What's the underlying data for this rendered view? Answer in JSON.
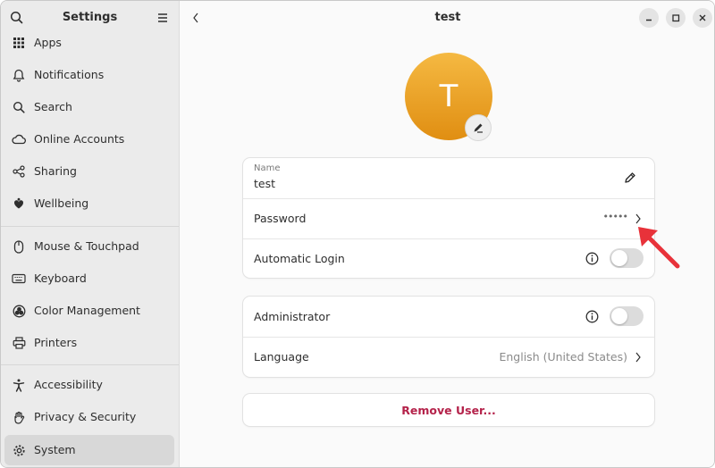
{
  "sidebar": {
    "title": "Settings",
    "items": [
      {
        "label": "Apps",
        "icon": "apps-grid-icon"
      },
      {
        "label": "Notifications",
        "icon": "bell-icon"
      },
      {
        "label": "Search",
        "icon": "search-icon"
      },
      {
        "label": "Online Accounts",
        "icon": "cloud-icon"
      },
      {
        "label": "Sharing",
        "icon": "share-icon"
      },
      {
        "label": "Wellbeing",
        "icon": "wellbeing-icon"
      },
      {
        "label": "Mouse & Touchpad",
        "icon": "mouse-icon"
      },
      {
        "label": "Keyboard",
        "icon": "keyboard-icon"
      },
      {
        "label": "Color Management",
        "icon": "color-icon"
      },
      {
        "label": "Printers",
        "icon": "printer-icon"
      },
      {
        "label": "Accessibility",
        "icon": "accessibility-icon"
      },
      {
        "label": "Privacy & Security",
        "icon": "hand-icon"
      },
      {
        "label": "System",
        "icon": "gear-icon",
        "active": true
      }
    ]
  },
  "header": {
    "title": "test"
  },
  "avatar": {
    "initial": "T",
    "color_top": "#f5b942",
    "color_bottom": "#e08e12"
  },
  "account": {
    "name_label": "Name",
    "name_value": "test",
    "password_label": "Password",
    "password_value": "•••••",
    "auto_login_label": "Automatic Login",
    "auto_login_enabled": false
  },
  "settings": {
    "administrator_label": "Administrator",
    "administrator_enabled": false,
    "language_label": "Language",
    "language_value": "English (United States)"
  },
  "actions": {
    "remove_label": "Remove User...",
    "remove_color": "#b4224a"
  },
  "annotation": {
    "arrow_color": "#e8323a",
    "target": "Password"
  }
}
